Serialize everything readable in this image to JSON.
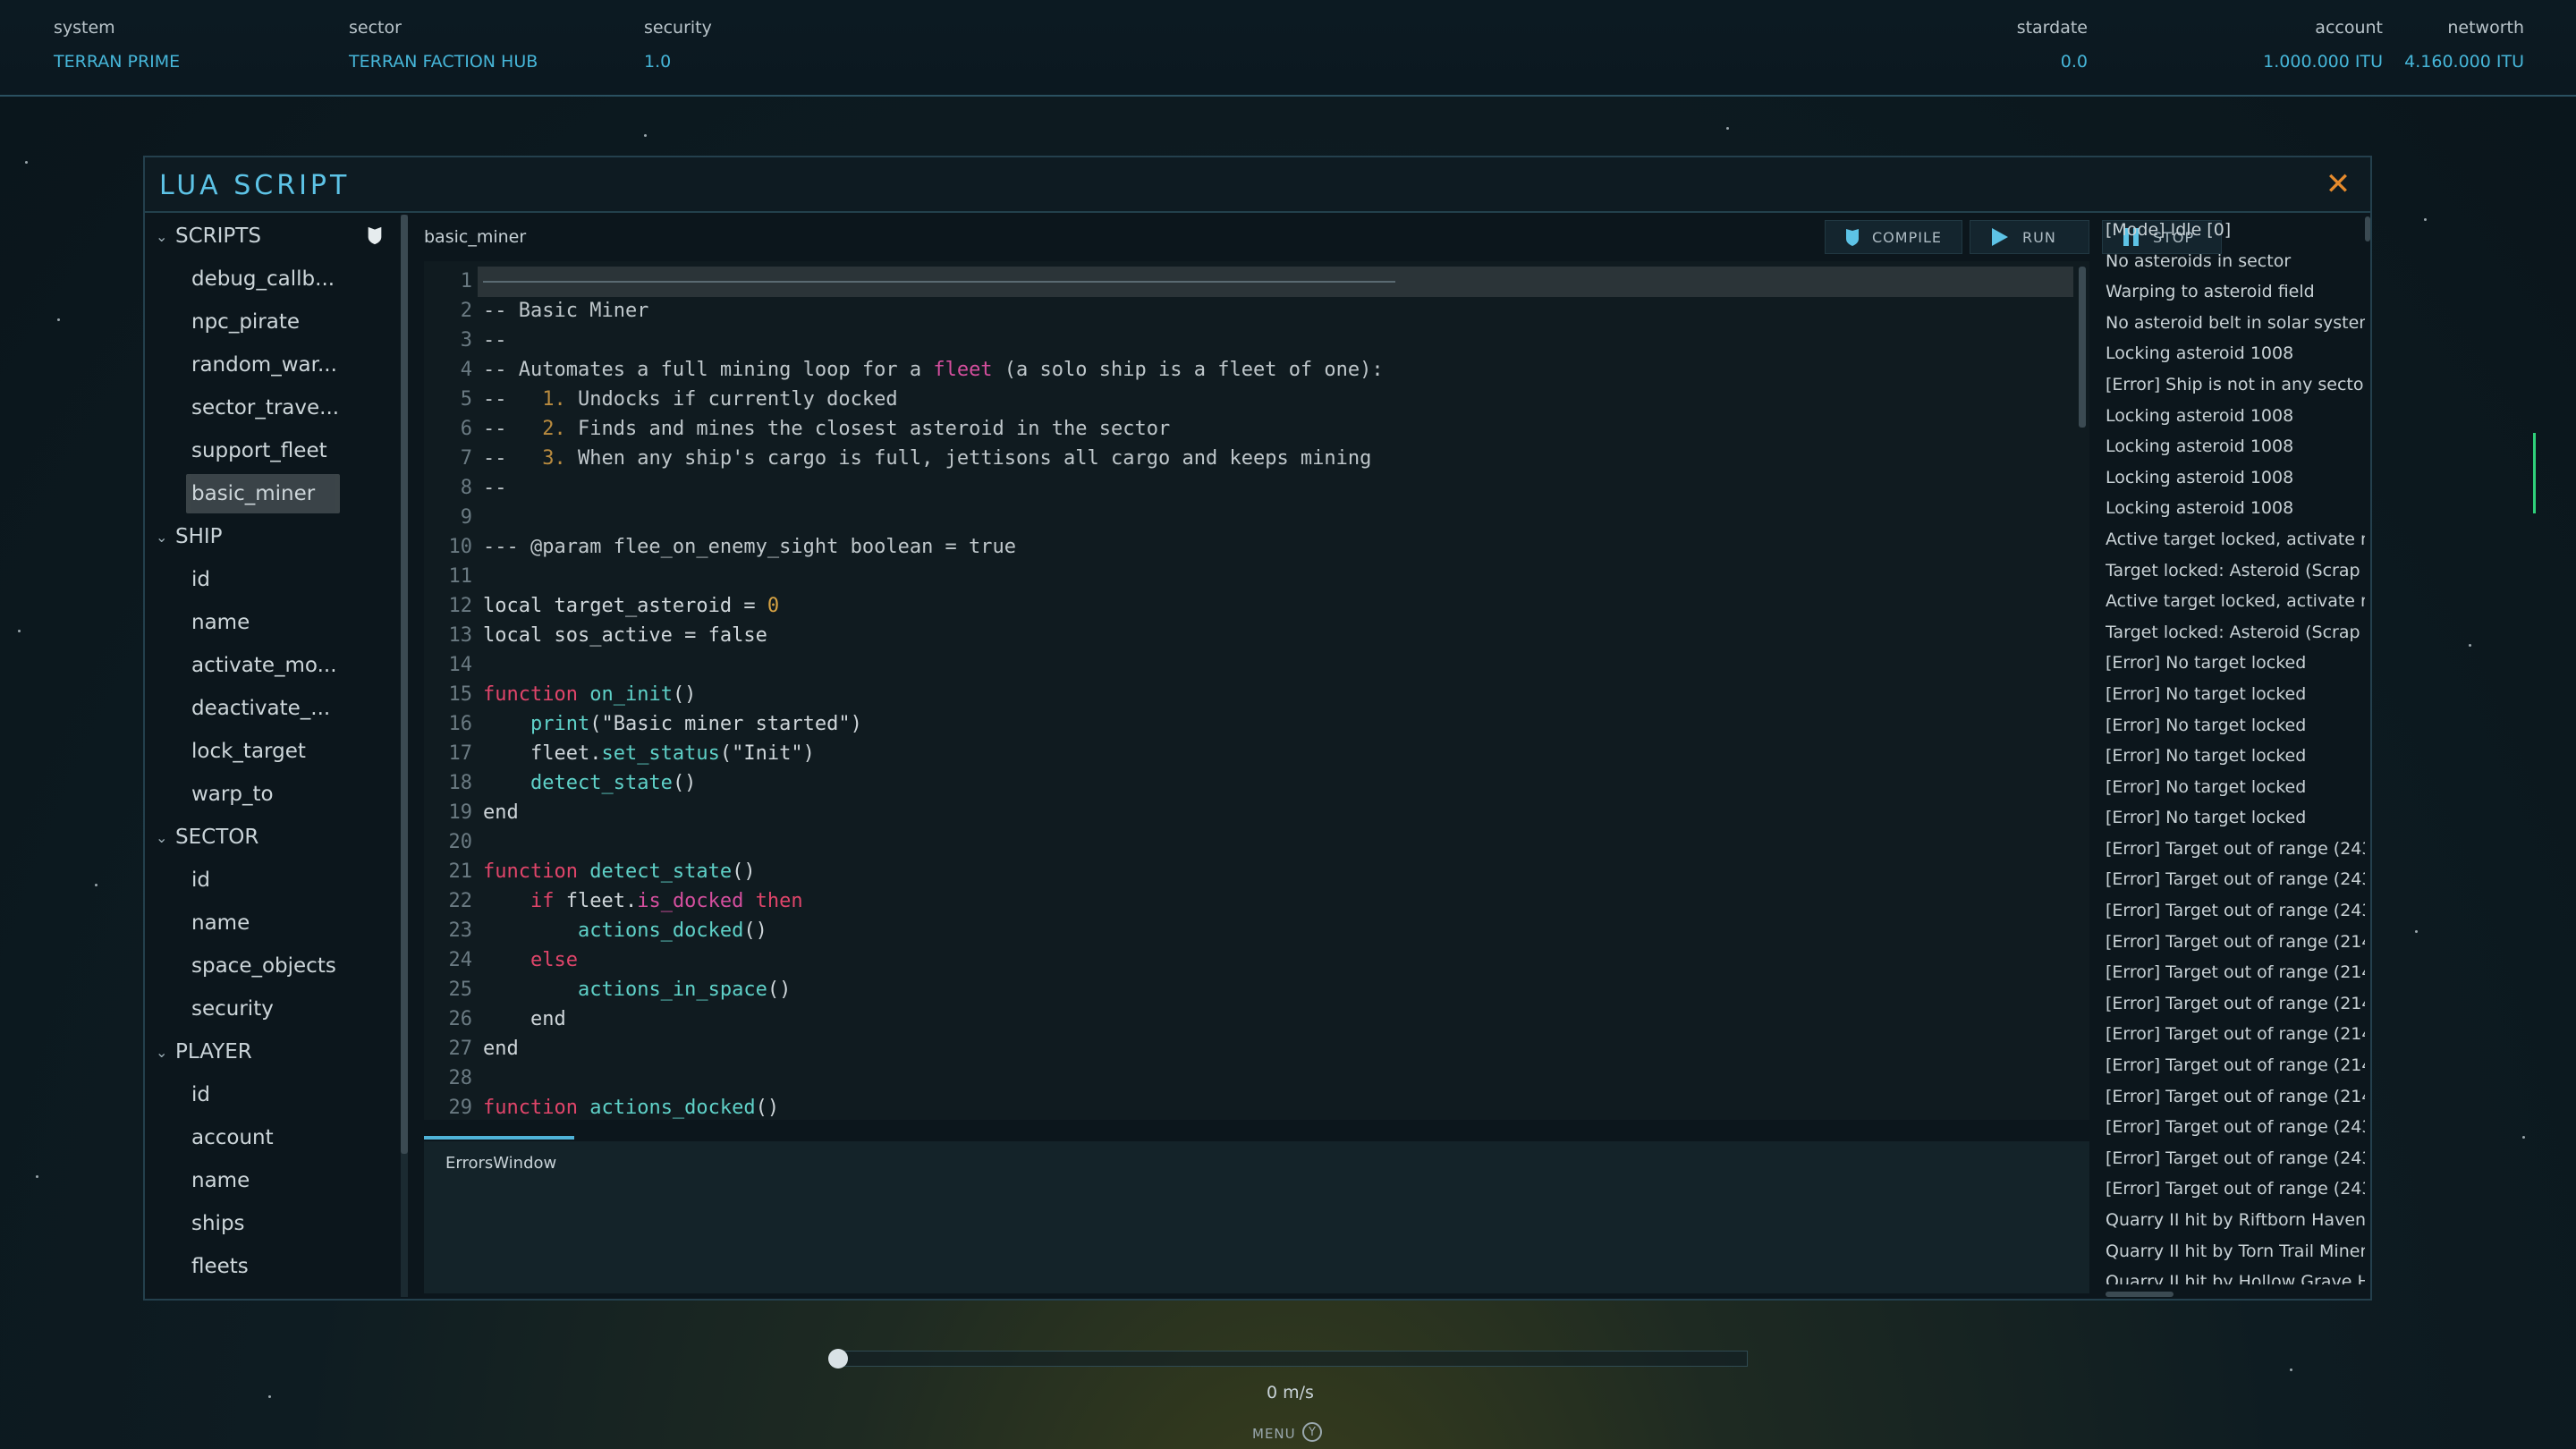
{
  "hud": {
    "system_label": "system",
    "system_value": "TERRAN PRIME",
    "sector_label": "sector",
    "sector_value": "TERRAN FACTION HUB",
    "security_label": "security",
    "security_value": "1.0",
    "stardate_label": "stardate",
    "stardate_value": "0.0",
    "account_label": "account",
    "account_value": "1.000.000 ITU",
    "networth_label": "networth",
    "networth_value": "4.160.000 ITU"
  },
  "window": {
    "title": "LUA SCRIPT"
  },
  "sidebar": {
    "sections": [
      {
        "title": "SCRIPTS",
        "items": [
          "debug_callb...",
          "npc_pirate",
          "random_war...",
          "sector_trave...",
          "support_fleet",
          "basic_miner"
        ],
        "active": "basic_miner"
      },
      {
        "title": "SHIP",
        "items": [
          "id",
          "name",
          "activate_mo...",
          "deactivate_...",
          "lock_target",
          "warp_to"
        ]
      },
      {
        "title": "SECTOR",
        "items": [
          "id",
          "name",
          "space_objects",
          "security"
        ]
      },
      {
        "title": "PLAYER",
        "items": [
          "id",
          "account",
          "name",
          "ships",
          "fleets"
        ]
      }
    ]
  },
  "editor": {
    "file_name": "basic_miner",
    "compile_label": "COMPILE",
    "run_label": "RUN",
    "stop_label": "STOP",
    "errors_tab": "ErrorsWindow",
    "lines": [
      {
        "n": "1",
        "t": ""
      },
      {
        "n": "2",
        "t": "-- Basic Miner"
      },
      {
        "n": "3",
        "t": "--"
      },
      {
        "n": "4",
        "t": "-- Automates a full mining loop for a fleet (a solo ship is a fleet of one):"
      },
      {
        "n": "5",
        "t": "--   1. Undocks if currently docked"
      },
      {
        "n": "6",
        "t": "--   2. Finds and mines the closest asteroid in the sector"
      },
      {
        "n": "7",
        "t": "--   3. When any ship's cargo is full, jettisons all cargo and keeps mining"
      },
      {
        "n": "8",
        "t": "--"
      },
      {
        "n": "9",
        "t": ""
      },
      {
        "n": "10",
        "t": "--- @param flee_on_enemy_sight boolean = true"
      },
      {
        "n": "11",
        "t": ""
      },
      {
        "n": "12",
        "t": "local target_asteroid = 0"
      },
      {
        "n": "13",
        "t": "local sos_active = false"
      },
      {
        "n": "14",
        "t": ""
      },
      {
        "n": "15",
        "t": "function on_init()"
      },
      {
        "n": "16",
        "t": "    print(\"Basic miner started\")"
      },
      {
        "n": "17",
        "t": "    fleet.set_status(\"Init\")"
      },
      {
        "n": "18",
        "t": "    detect_state()"
      },
      {
        "n": "19",
        "t": "end"
      },
      {
        "n": "20",
        "t": ""
      },
      {
        "n": "21",
        "t": "function detect_state()"
      },
      {
        "n": "22",
        "t": "    if fleet.is_docked then"
      },
      {
        "n": "23",
        "t": "        actions_docked()"
      },
      {
        "n": "24",
        "t": "    else"
      },
      {
        "n": "25",
        "t": "        actions_in_space()"
      },
      {
        "n": "26",
        "t": "    end"
      },
      {
        "n": "27",
        "t": "end"
      },
      {
        "n": "28",
        "t": ""
      },
      {
        "n": "29",
        "t": "function actions_docked()"
      }
    ]
  },
  "log": [
    "[Mode] Idle [0]",
    "No asteroids in sector",
    "Warping to asteroid field",
    "No asteroid belt in solar system",
    "Locking asteroid 1008",
    "[Error] Ship is not in any sector",
    "Locking asteroid 1008",
    "Locking asteroid 1008",
    "Locking asteroid 1008",
    "Locking asteroid 1008",
    "Active target locked, activate m",
    "Target locked: Asteroid (Scrap",
    "Active target locked, activate m",
    "Target locked: Asteroid (Scrap",
    "[Error] No target locked",
    "[Error] No target locked",
    "[Error] No target locked",
    "[Error] No target locked",
    "[Error] No target locked",
    "[Error] No target locked",
    "[Error] Target out of range (243",
    "[Error] Target out of range (243",
    "[Error] Target out of range (243",
    "[Error] Target out of range (214",
    "[Error] Target out of range (214",
    "[Error] Target out of range (214",
    "[Error] Target out of range (214",
    "[Error] Target out of range (214",
    "[Error] Target out of range (214",
    "[Error] Target out of range (243",
    "[Error] Target out of range (243",
    "[Error] Target out of range (243",
    "Quarry II hit by Riftborn Haven",
    "Quarry II hit by Torn Trail Miner",
    "Quarry II hit by Hollow Grave Ha"
  ],
  "bottom": {
    "speed": "0 m/s",
    "menu": "MENU",
    "menu_key": "Y",
    "throttle_fraction": 0
  },
  "colors": {
    "accent": "#5dc3e6",
    "close": "#e58a2c",
    "keyword": "#e0456a",
    "function": "#5fd1c8",
    "number": "#d6a243"
  },
  "icons": {
    "close": "close-icon",
    "compile": "shield-icon",
    "run": "play-icon",
    "stop": "pause-icon",
    "sidebar": "shield-icon"
  }
}
